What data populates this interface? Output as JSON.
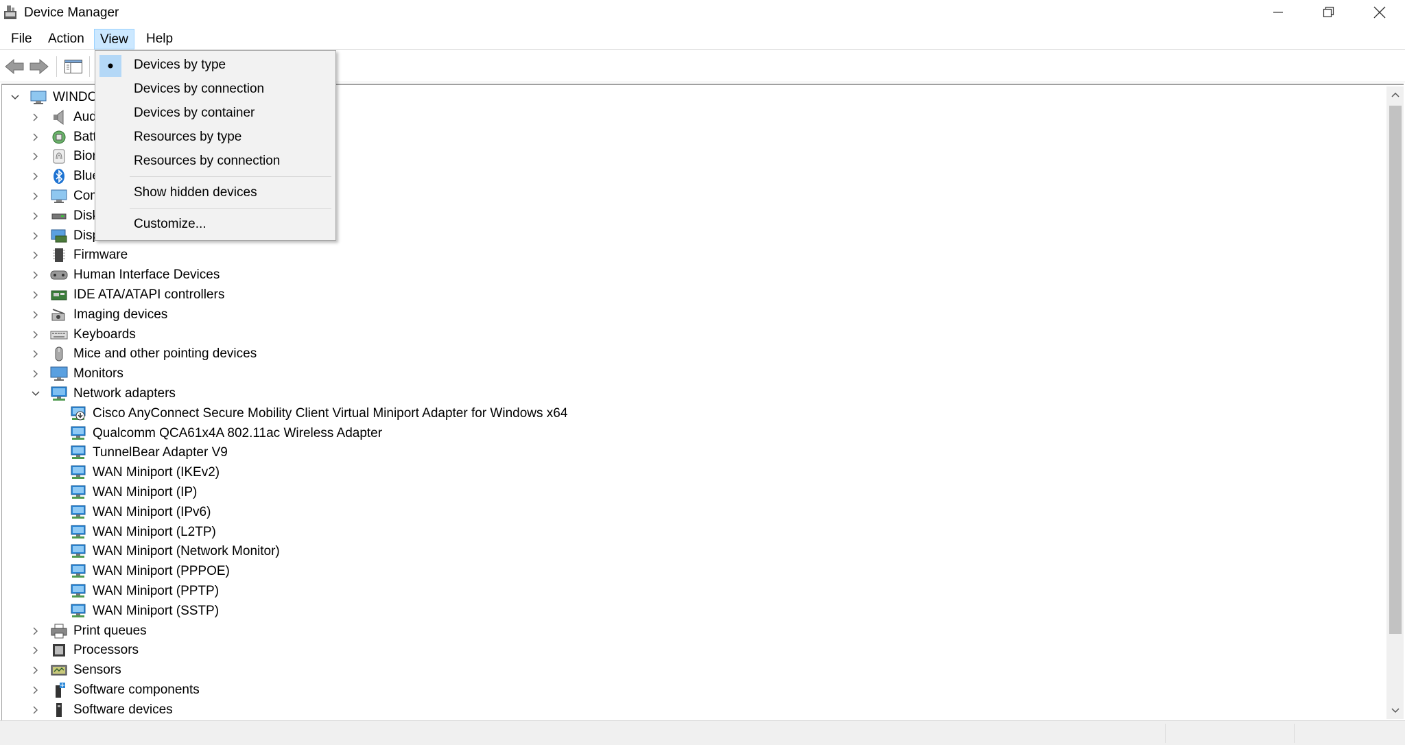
{
  "window": {
    "title": "Device Manager"
  },
  "menubar": {
    "items": [
      "File",
      "Action",
      "View",
      "Help"
    ],
    "active": "View"
  },
  "view_menu": {
    "items": [
      {
        "label": "Devices by type",
        "checked": true
      },
      {
        "label": "Devices by connection",
        "checked": false
      },
      {
        "label": "Devices by container",
        "checked": false
      },
      {
        "label": "Resources by type",
        "checked": false
      },
      {
        "label": "Resources by connection",
        "checked": false
      },
      {
        "label": "Show hidden devices",
        "checked": false
      },
      {
        "label": "Customize...",
        "checked": false
      }
    ]
  },
  "tree": {
    "root": "WINDO",
    "categories": [
      {
        "label": "Aud",
        "icon": "speaker-icon"
      },
      {
        "label": "Batt",
        "icon": "battery-icon"
      },
      {
        "label": "Bior",
        "icon": "fingerprint-icon"
      },
      {
        "label": "Blue",
        "icon": "bluetooth-icon"
      },
      {
        "label": "Com",
        "icon": "computer-icon"
      },
      {
        "label": "Disk",
        "icon": "disk-drive-icon"
      },
      {
        "label": "Disp",
        "icon": "display-adapter-icon"
      },
      {
        "label": "Firmware",
        "icon": "firmware-chip-icon"
      },
      {
        "label": "Human Interface Devices",
        "icon": "hid-icon"
      },
      {
        "label": "IDE ATA/ATAPI controllers",
        "icon": "ide-controller-icon"
      },
      {
        "label": "Imaging devices",
        "icon": "camera-icon"
      },
      {
        "label": "Keyboards",
        "icon": "keyboard-icon"
      },
      {
        "label": "Mice and other pointing devices",
        "icon": "mouse-icon"
      },
      {
        "label": "Monitors",
        "icon": "monitor-icon"
      },
      {
        "label": "Network adapters",
        "icon": "network-adapter-icon",
        "expanded": true,
        "children": [
          "Cisco AnyConnect Secure Mobility Client Virtual Miniport Adapter for Windows x64",
          "Qualcomm QCA61x4A 802.11ac Wireless Adapter",
          "TunnelBear Adapter V9",
          "WAN Miniport (IKEv2)",
          "WAN Miniport (IP)",
          "WAN Miniport (IPv6)",
          "WAN Miniport (L2TP)",
          "WAN Miniport (Network Monitor)",
          "WAN Miniport (PPPOE)",
          "WAN Miniport (PPTP)",
          "WAN Miniport (SSTP)"
        ]
      },
      {
        "label": "Print queues",
        "icon": "printer-icon"
      },
      {
        "label": "Processors",
        "icon": "processor-icon"
      },
      {
        "label": "Sensors",
        "icon": "sensor-icon"
      },
      {
        "label": "Software components",
        "icon": "software-component-icon"
      },
      {
        "label": "Software devices",
        "icon": "software-device-icon"
      }
    ]
  },
  "colors": {
    "menu_highlight": "#cce8ff",
    "check_bg": "#b4d8f7",
    "network_icon": "#2b88d8"
  }
}
